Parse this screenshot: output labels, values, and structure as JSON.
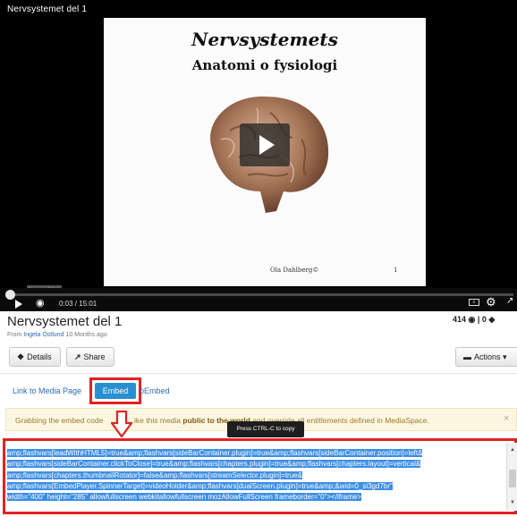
{
  "player": {
    "title": "Nervsystemet del 1",
    "slide_title": "Nervsystemets",
    "slide_subtitle": "Anatomi o fysiologi",
    "slide_author": "Ola Dahlberg©",
    "slide_page": "1",
    "watermark": "Screencast-O-Matic",
    "time": "0:03 / 15:01",
    "progress": 0.003
  },
  "entry": {
    "title": "Nervsystemet del 1",
    "meta_prefix": "From",
    "owner": "Ingela Östlund",
    "meta_suffix": "10 Months ago",
    "stats": "414 ◉ | 0 ◆"
  },
  "buttons": {
    "details": "Details",
    "share": "Share",
    "actions": "Actions ▾"
  },
  "tabs": {
    "link": "Link to Media Page",
    "embed": "Embed",
    "oembed": "oEmbed"
  },
  "alert": {
    "text_a": "Grabbing the embed code",
    "text_b": "ike this media",
    "bold": "public to the world",
    "text_c": "and override all entitlements defined in MediaSpace."
  },
  "tooltip": "Press CTRL-C to copy",
  "embed_code": [
    "amp;flashvars[leadWithHTML5]=true&amp;flashvars[sideBarContainer.plugin]=true&amp;flashvars[sideBarContainer.position]=left&",
    "amp;flashvars[sideBarContainer.clickToClose]=true&amp;flashvars[chapters.plugin]=true&amp;flashvars[chapters.layout]=vertical&",
    "amp;flashvars[chapters.thumbnailRotator]=false&amp;flashvars[streamSelector.plugin]=true&",
    "amp;flashvars[EmbedPlayer.SpinnerTarget]=videoHolder&amp;flashvars[dualScreen.plugin]=true&amp;&wid=0_si3gd7br\"",
    "width=\"400\" height=\"285\" allowfullscreen webkitallowfullscreen mozAllowFullScreen frameborder=\"0\"></iframe>"
  ],
  "colors": {
    "accent": "#2a8fd1",
    "highlight_outline": "#e32222",
    "selection": "#3d8ee5"
  }
}
